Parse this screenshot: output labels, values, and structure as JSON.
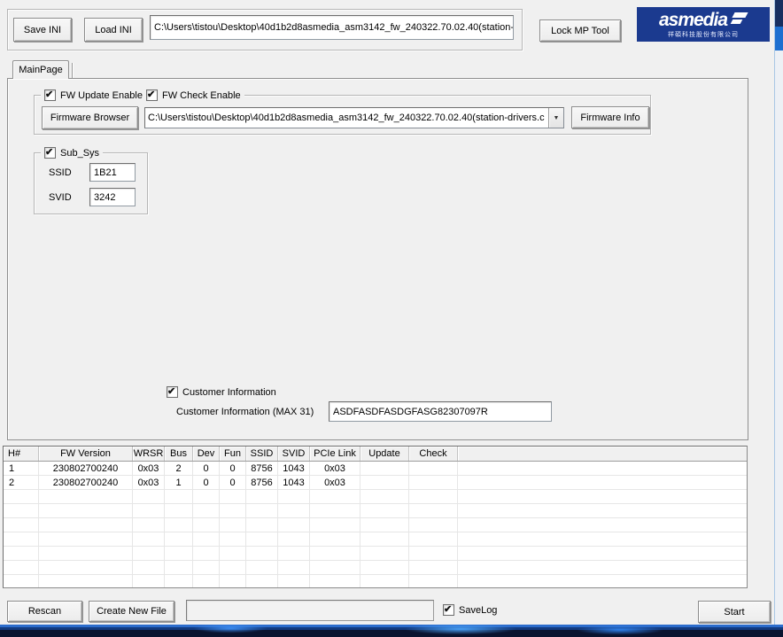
{
  "colors": {
    "brand_blue": "#1b3a8f",
    "desktop_blue": "#1d6fd0",
    "desktop_dark": "#0a1430"
  },
  "toolbar": {
    "save_ini_label": "Save INI",
    "load_ini_label": "Load INI",
    "ini_path": "C:\\Users\\tistou\\Desktop\\40d1b2d8asmedia_asm3142_fw_240322.70.02.40(station-",
    "lock_mp_tool_label": "Lock MP Tool"
  },
  "logo": {
    "brand": "asmedia",
    "subtitle": "祥碩科技股份有限公司"
  },
  "tabs": {
    "mainpage_label": "MainPage"
  },
  "fw_group": {
    "update_enable_label": "FW Update Enable",
    "update_enable_checked": true,
    "check_enable_label": "FW Check Enable",
    "check_enable_checked": true,
    "browser_button_label": "Firmware Browser",
    "fw_path": "C:\\Users\\tistou\\Desktop\\40d1b2d8asmedia_asm3142_fw_240322.70.02.40(station-drivers.c",
    "info_button_label": "Firmware Info"
  },
  "subsys": {
    "group_label": "Sub_Sys",
    "checked": true,
    "ssid_label": "SSID",
    "ssid_value": "1B21",
    "svid_label": "SVID",
    "svid_value": "3242"
  },
  "customer": {
    "checkbox_label": "Customer Information",
    "checked": true,
    "field_label": "Customer Information (MAX 31)",
    "value": "ASDFASDFASDGFASG82307097R"
  },
  "device_table": {
    "columns": [
      "H#",
      "FW Version",
      "WRSR",
      "Bus",
      "Dev",
      "Fun",
      "SSID",
      "SVID",
      "PCIe Link",
      "Update",
      "Check"
    ],
    "rows": [
      [
        "1",
        "230802700240",
        "0x03",
        "2",
        "0",
        "0",
        "8756",
        "1043",
        "0x03",
        "",
        ""
      ],
      [
        "2",
        "230802700240",
        "0x03",
        "1",
        "0",
        "0",
        "8756",
        "1043",
        "0x03",
        "",
        ""
      ]
    ],
    "empty_row_count": 7
  },
  "bottom": {
    "rescan_label": "Rescan",
    "create_new_file_label": "Create New File",
    "savelog_label": "SaveLog",
    "savelog_checked": true,
    "start_label": "Start"
  }
}
